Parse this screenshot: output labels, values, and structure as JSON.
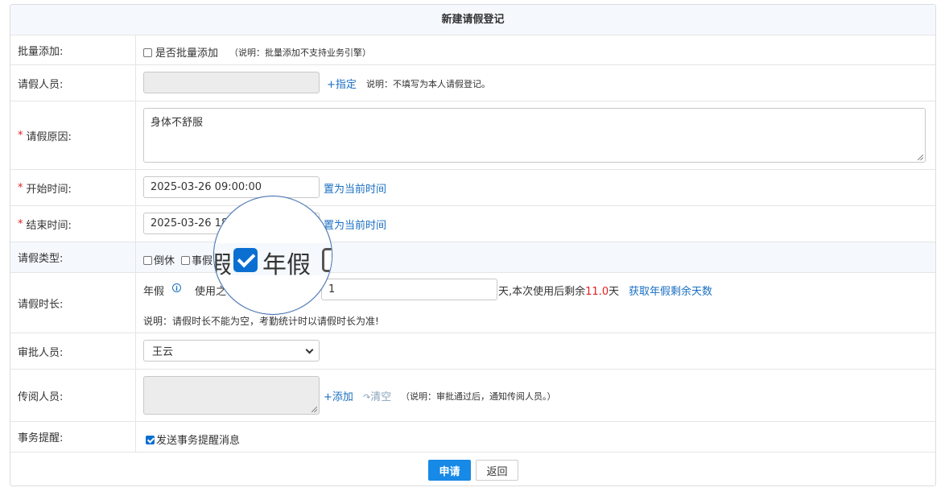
{
  "form": {
    "title": "新建请假登记",
    "batch": {
      "label": "批量添加:",
      "checkbox_label": "是否批量添加",
      "note": "（说明：批量添加不支持业务引擎）"
    },
    "person": {
      "label": "请假人员:",
      "assign_link": "+指定",
      "note": "说明：不填写为本人请假登记。"
    },
    "reason": {
      "required_mark": "*",
      "label": "请假原因:",
      "value": "身体不舒服"
    },
    "start_time": {
      "required_mark": "*",
      "label": "开始时间:",
      "value": "2025-03-26 09:00:00",
      "set_now_link": "置为当前时间"
    },
    "end_time": {
      "required_mark": "*",
      "label": "结束时间:",
      "value_visible": "2025-03-26 18",
      "set_now_link": "置为当前时间"
    },
    "leave_type": {
      "label": "请假类型:",
      "options": [
        "倒休",
        "事假"
      ]
    },
    "duration": {
      "label": "请假时长:",
      "type_name": "年假",
      "use_prefix": "使用之",
      "value": "1",
      "suffix_text": "天,本次使用后剩余",
      "remaining": "11.0",
      "unit": "天",
      "fetch_link": "获取年假剩余天数",
      "note": "说明：请假时长不能为空，考勤统计时以请假时长为准!"
    },
    "approver": {
      "label": "审批人员:",
      "selected": "王云"
    },
    "circulate": {
      "label": "传阅人员:",
      "add_link": "+添加",
      "clear_link": "清空",
      "note": "（说明：审批通过后，通知传阅人员。）"
    },
    "reminder": {
      "label": "事务提醒:",
      "checkbox_label": "发送事务提醒消息",
      "checked": true
    },
    "buttons": {
      "submit": "申请",
      "back": "返回"
    }
  },
  "magnifier": {
    "prev_char": "假",
    "text": "年假",
    "checked": true
  },
  "colors": {
    "primary": "#1789e6",
    "link": "#1a6fc2",
    "required": "#e02020",
    "checkbox_checked": "#0b6fd1"
  }
}
